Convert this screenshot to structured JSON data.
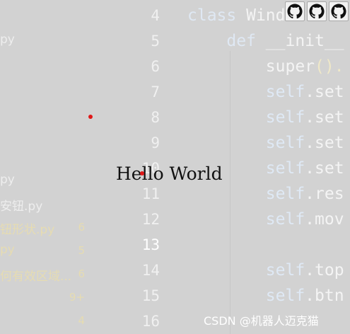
{
  "window": {
    "title": "Hello World",
    "toolbar": {
      "buttons": [
        {
          "icon": "github-icon"
        },
        {
          "icon": "github-icon"
        },
        {
          "icon": "github-icon"
        }
      ]
    }
  },
  "background": {
    "explorer": {
      "items": [
        {
          "label": "py",
          "badge": "",
          "modified": false
        },
        {
          "label": "py",
          "badge": "",
          "modified": false
        },
        {
          "label": "安钮.py",
          "badge": "",
          "modified": false
        },
        {
          "label": "钮形状.py",
          "badge": "6",
          "modified": true
        },
        {
          "label": "py",
          "badge": "5",
          "modified": true
        },
        {
          "label": "何有效区域...",
          "badge": "6",
          "modified": true
        },
        {
          "label": "",
          "badge": "9+",
          "modified": true
        },
        {
          "label": "",
          "badge": "4",
          "modified": true
        }
      ]
    },
    "editor": {
      "line_numbers": [
        "4",
        "5",
        "6",
        "7",
        "8",
        "9",
        "10",
        "11",
        "12",
        "13",
        "14",
        "15",
        "16"
      ],
      "active_line": "13",
      "code_lines": [
        [
          {
            "t": "class ",
            "k": "kw"
          },
          {
            "t": "Windo",
            "k": "name"
          }
        ],
        [
          {
            "t": "    def ",
            "k": "kw"
          },
          {
            "t": "__init__",
            "k": "fn"
          }
        ],
        [
          {
            "t": "        super",
            "k": "fn"
          },
          {
            "t": "().",
            "k": "punc"
          }
        ],
        [
          {
            "t": "        self",
            "k": "self"
          },
          {
            "t": ".set",
            "k": "fn"
          }
        ],
        [
          {
            "t": "        self",
            "k": "self"
          },
          {
            "t": ".set",
            "k": "fn"
          }
        ],
        [
          {
            "t": "        self",
            "k": "self"
          },
          {
            "t": ".set",
            "k": "fn"
          }
        ],
        [
          {
            "t": "        self",
            "k": "self"
          },
          {
            "t": ".set",
            "k": "fn"
          }
        ],
        [
          {
            "t": "        self",
            "k": "self"
          },
          {
            "t": ".res",
            "k": "fn"
          }
        ],
        [
          {
            "t": "        self",
            "k": "self"
          },
          {
            "t": ".mov",
            "k": "fn"
          }
        ],
        [
          {
            "t": "",
            "k": "fn"
          }
        ],
        [
          {
            "t": "        self",
            "k": "self"
          },
          {
            "t": ".top",
            "k": "fn"
          }
        ],
        [
          {
            "t": "        self",
            "k": "self"
          },
          {
            "t": ".btn",
            "k": "fn"
          }
        ],
        [
          {
            "t": "",
            "k": "fn"
          }
        ]
      ]
    }
  },
  "watermark": "CSDN @机器人迈克猫"
}
